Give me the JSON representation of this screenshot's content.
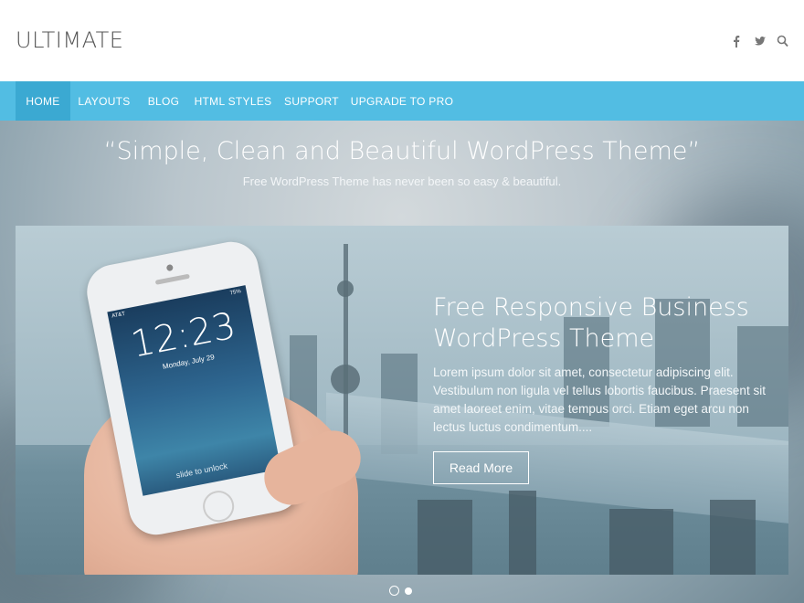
{
  "header": {
    "logo": "ULTIMATE",
    "icons": [
      "facebook-icon",
      "twitter-icon",
      "search-icon"
    ]
  },
  "nav": {
    "items": [
      {
        "label": "HOME",
        "active": true
      },
      {
        "label": "LAYOUTS",
        "active": false
      },
      {
        "label": "BLOG",
        "active": false
      },
      {
        "label": "HTML STYLES",
        "active": false
      },
      {
        "label": "SUPPORT",
        "active": false
      },
      {
        "label": "UPGRADE TO PRO",
        "active": false
      }
    ],
    "bg_color": "#52bde3",
    "active_color": "#3ba9d2"
  },
  "hero": {
    "quote": "“Simple, Clean and Beautiful WordPress Theme”",
    "subtitle": "Free WordPress Theme has never been so easy & beautiful."
  },
  "slide": {
    "title_line1": "Free Responsive Business",
    "title_line2": "WordPress Theme",
    "text": "Lorem ipsum dolor sit amet, consectetur adipiscing elit. Vestibulum non ligula vel tellus lobortis faucibus. Praesent sit amet laoreet enim, vitae tempus orci. Etiam eget arcu non lectus luctus condimentum....",
    "button": "Read More",
    "phone": {
      "time": "12:23",
      "date": "Monday, July 29",
      "carrier": "AT&T",
      "battery": "75%",
      "unlock": "slide to unlock"
    }
  },
  "slider": {
    "slide_count": 2,
    "active_index": 0
  }
}
